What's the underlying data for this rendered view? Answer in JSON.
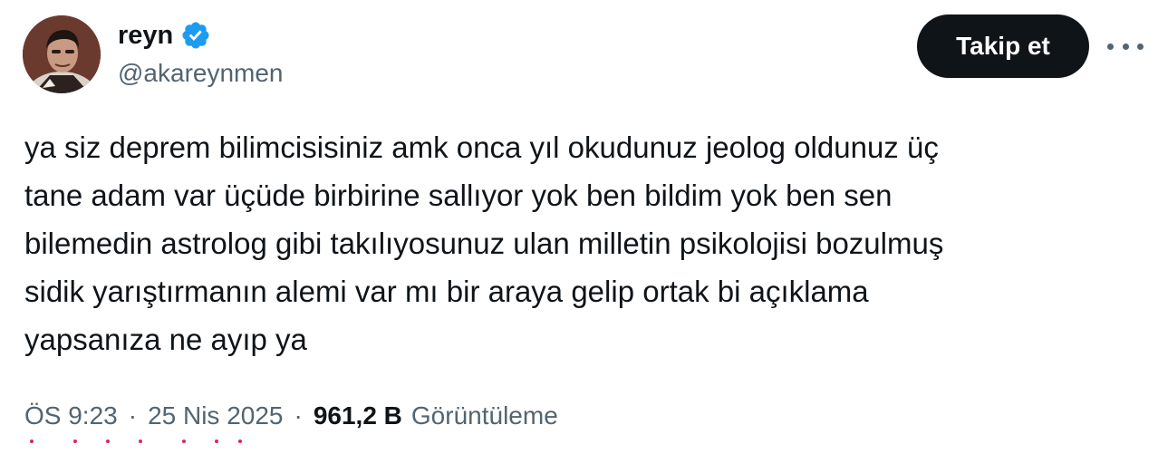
{
  "user": {
    "display_name": "reyn",
    "handle": "@akareynmen",
    "verified_icon": "verified-badge-icon",
    "verified_color": "#1d9bf0"
  },
  "actions": {
    "follow_label": "Takip et",
    "more_icon": "more-horizontal-icon"
  },
  "tweet": {
    "text": "ya siz deprem bilimcisisiniz amk onca yıl okudunuz jeolog oldunuz üç\ntane adam var üçüde birbirine sallıyor yok ben bildim yok ben sen\nbilemedin astrolog gibi takılıyosunuz ulan milletin psikolojisi bozulmuş\nsidik yarıştırmanın alemi var mı bir araya gelip ortak bi açıklama\nyapsanıza ne ayıp ya"
  },
  "meta": {
    "time": "ÖS 9:23",
    "separator": "·",
    "date": "25 Nis 2025",
    "views_count": "961,2 B",
    "views_label": "Görüntüleme"
  },
  "colors": {
    "text": "#0f1419",
    "secondary": "#536471",
    "button_bg": "#0f1419",
    "button_text": "#ffffff"
  }
}
